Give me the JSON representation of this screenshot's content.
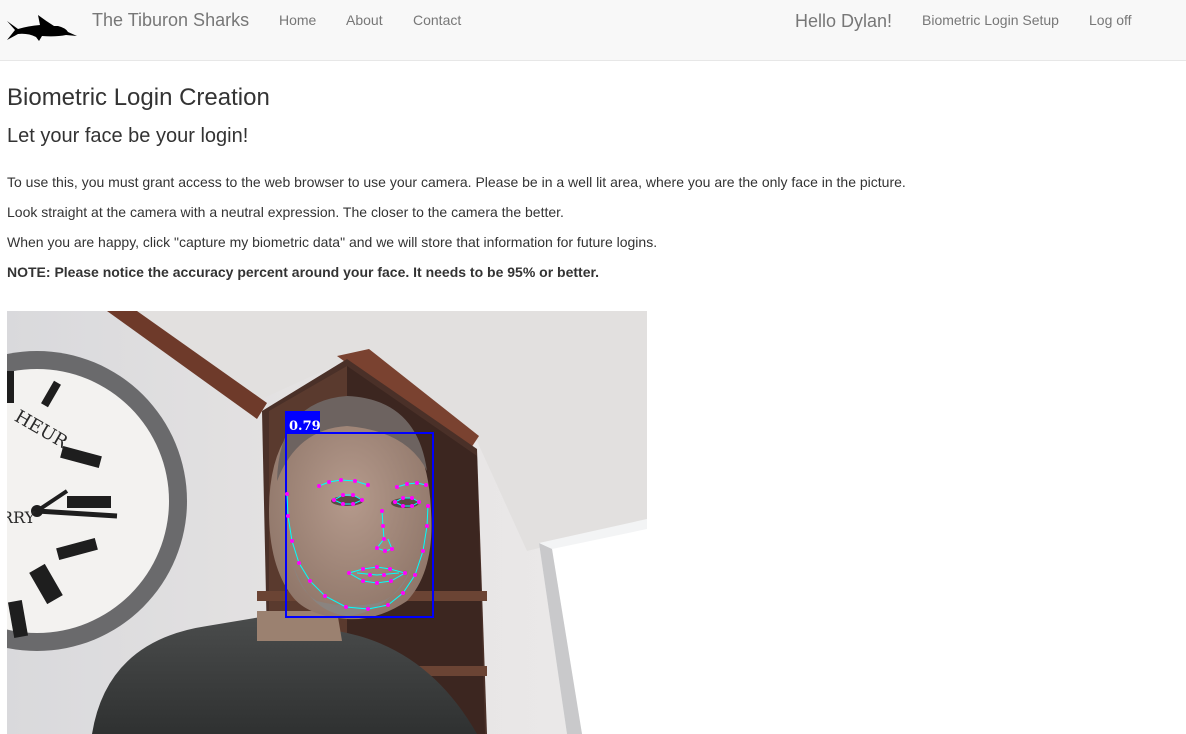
{
  "navbar": {
    "brand": "The Tiburon Sharks",
    "links": {
      "home": "Home",
      "about": "About",
      "contact": "Contact"
    },
    "greeting": "Hello Dylan!",
    "biometric_setup": "Biometric Login Setup",
    "logoff": "Log off"
  },
  "main": {
    "title": "Biometric Login Creation",
    "subtitle": "Let your face be your login!",
    "paragraphs": [
      "To use this, you must grant access to the web browser to use your camera. Please be in a well lit area, where you are the only face in the picture.",
      "Look straight at the camera with a neutral expression. The closer to the camera the better.",
      "When you are happy, click \"capture my biometric data\" and we will store that information for future logins."
    ],
    "note": "NOTE: Please notice the accuracy percent around your face. It needs to be 95% or better."
  },
  "camera": {
    "confidence_label": "0.79",
    "confidence": 0.79,
    "box_color": "#0000ff",
    "landmark_color": "#ff00ff",
    "contour_color": "#00ffff",
    "clock_text_top": "HEUR",
    "clock_text_bottom": "RRY"
  }
}
